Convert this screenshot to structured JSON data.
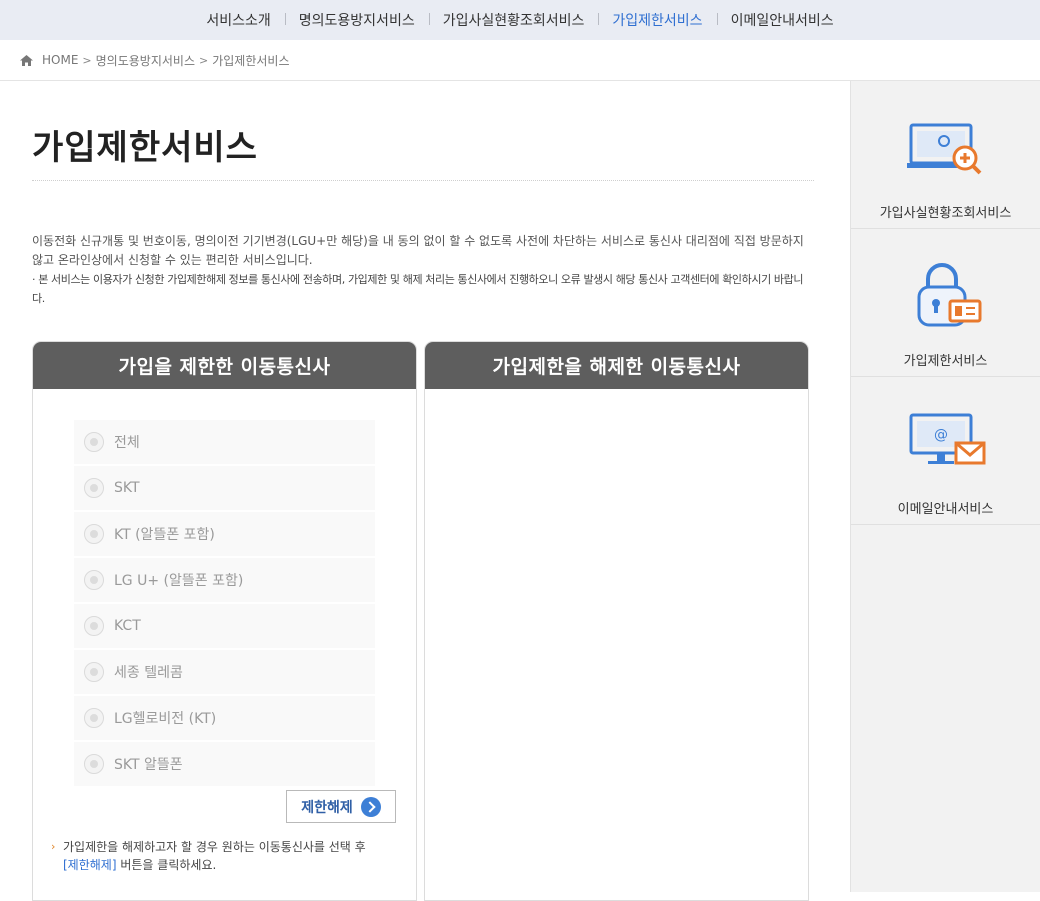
{
  "topnav": {
    "items": [
      "서비스소개",
      "명의도용방지서비스",
      "가입사실현황조회서비스",
      "가입제한서비스",
      "이메일안내서비스"
    ],
    "active_index": 3
  },
  "breadcrumb": {
    "home": "HOME",
    "level1": "명의도용방지서비스",
    "level2": "가입제한서비스"
  },
  "page": {
    "title": "가입제한서비스",
    "description": "이동전화 신규개통 및 번호이동, 명의이전 기기변경(LGU+만 해당)을 내 동의 없이 할 수 없도록 사전에 차단하는 서비스로 통신사 대리점에 직접 방문하지 않고 온라인상에서 신청할 수 있는 편리한 서비스입니다.",
    "note": "· 본 서비스는 이용자가 신청한 가입제한해제 정보를 통신사에 전송하며, 가입제한 및 해제 처리는 통신사에서 진행하오니 오류 발생시 해당 통신사 고객센터에 확인하시기 바랍니다."
  },
  "panel_restricted": {
    "title": "가입을 제한한 이동통신사",
    "options": [
      "전체",
      "SKT",
      "KT (알뜰폰 포함)",
      "LG U+ (알뜰폰 포함)",
      "KCT",
      "세종 텔레콤",
      "LG헬로비전 (KT)",
      "SKT 알뜰폰"
    ],
    "release_button": "제한해제",
    "guide_text": "가입제한을 해제하고자 할 경우 원하는 이동통신사를 선택 후",
    "guide_highlight": "[제한해제]",
    "guide_tail": " 버튼을 클릭하세요."
  },
  "panel_released": {
    "title": "가입제한을 해제한 이동통신사"
  },
  "sidebar": {
    "items": [
      {
        "label": "가입사실현황조회서비스",
        "icon": "monitor-search-icon"
      },
      {
        "label": "가입제한서비스",
        "icon": "lock-id-icon"
      },
      {
        "label": "이메일안내서비스",
        "icon": "monitor-email-icon"
      }
    ]
  },
  "colors": {
    "accent": "#2f6fd1",
    "panel_header": "#5e5e5e",
    "icon_blue": "#3d7fd6",
    "icon_orange": "#e8792d"
  }
}
